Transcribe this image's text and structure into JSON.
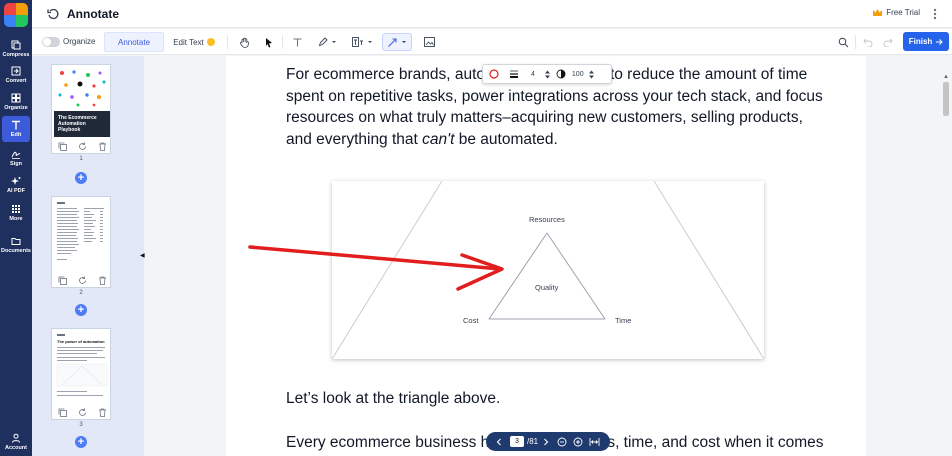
{
  "app": {
    "title": "Annotate",
    "free_trial_label": "Free Trial"
  },
  "rail": {
    "items": [
      {
        "label": "Compress",
        "icon": "compress-icon"
      },
      {
        "label": "Convert",
        "icon": "convert-icon"
      },
      {
        "label": "Organize",
        "icon": "organize-icon"
      },
      {
        "label": "Edit",
        "icon": "edit-text-icon",
        "active": true
      },
      {
        "label": "Sign",
        "icon": "sign-icon"
      },
      {
        "label": "AI PDF",
        "icon": "ai-sparkle-icon"
      },
      {
        "label": "More",
        "icon": "grid-icon"
      },
      {
        "label": "Documents",
        "icon": "folder-icon"
      },
      {
        "label": "Account",
        "icon": "account-icon"
      }
    ]
  },
  "toolbar": {
    "organize_label": "Organize",
    "tab_annotate": "Annotate",
    "tab_edit_text": "Edit Text",
    "finish_label": "Finish"
  },
  "annotation_popup": {
    "stroke_width": "4",
    "opacity": "100"
  },
  "thumbnails": {
    "pages": [
      {
        "number": "1",
        "title": "The Ecommerce Automation Playbook"
      },
      {
        "number": "2"
      },
      {
        "number": "3",
        "heading": "The power of automation"
      }
    ]
  },
  "document": {
    "para1_a": "For ecommerce brands, auto",
    "para1_b": "u to reduce the amount of time",
    "para1_line2": "spent on repetitive tasks, power integrations across your tech stack, and focus",
    "para1_line3": "resources on what truly matters–acquiring new customers, selling products,",
    "para1_line4_a": "and everything that ",
    "para1_line4_em": "can't",
    "para1_line4_b": " be automated.",
    "figure_labels": {
      "resources": "Resources",
      "quality": "Quality",
      "cost": "Cost",
      "time": "Time"
    },
    "para2": "Let’s look at the triangle above.",
    "para3_a": "Every ecommerce business h",
    "para3_b": "s, time, and cost when it comes"
  },
  "pagenav": {
    "current": "3",
    "total": "/81"
  },
  "colors": {
    "accent": "#2563eb",
    "rail_bg": "#1f2f5e",
    "arrow": "#e11d1d"
  }
}
